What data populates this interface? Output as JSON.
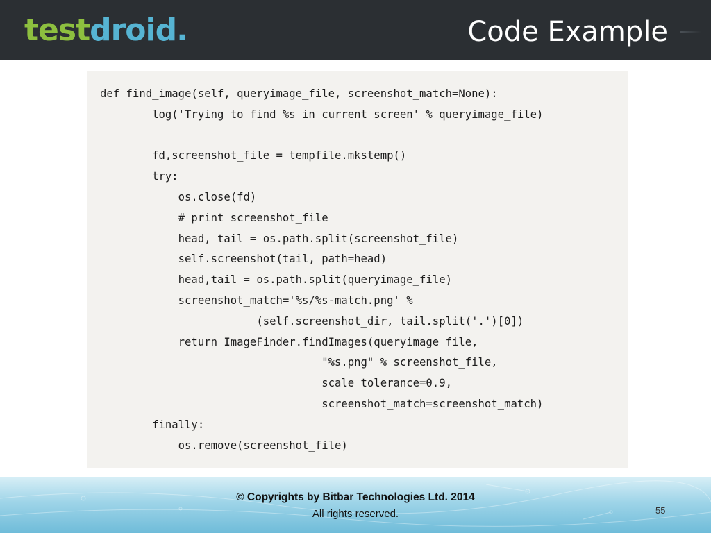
{
  "header": {
    "logo_part1": "test",
    "logo_part2": "droid",
    "logo_dot": ".",
    "title": "Code Example"
  },
  "code": {
    "lines": [
      "def find_image(self, queryimage_file, screenshot_match=None):",
      "        log('Trying to find %s in current screen' % queryimage_file)",
      "",
      "        fd,screenshot_file = tempfile.mkstemp()",
      "        try:",
      "            os.close(fd)",
      "            # print screenshot_file",
      "            head, tail = os.path.split(screenshot_file)",
      "            self.screenshot(tail, path=head)",
      "            head,tail = os.path.split(queryimage_file)",
      "            screenshot_match='%s/%s-match.png' %",
      "                        (self.screenshot_dir, tail.split('.')[0])",
      "            return ImageFinder.findImages(queryimage_file,",
      "                                  \"%s.png\" % screenshot_file,",
      "                                  scale_tolerance=0.9,",
      "                                  screenshot_match=screenshot_match)",
      "        finally:",
      "            os.remove(screenshot_file)"
    ]
  },
  "footer": {
    "copyright": "© Copyrights by Bitbar Technologies Ltd. 2014",
    "rights": "All rights reserved.",
    "page_number": "55"
  }
}
